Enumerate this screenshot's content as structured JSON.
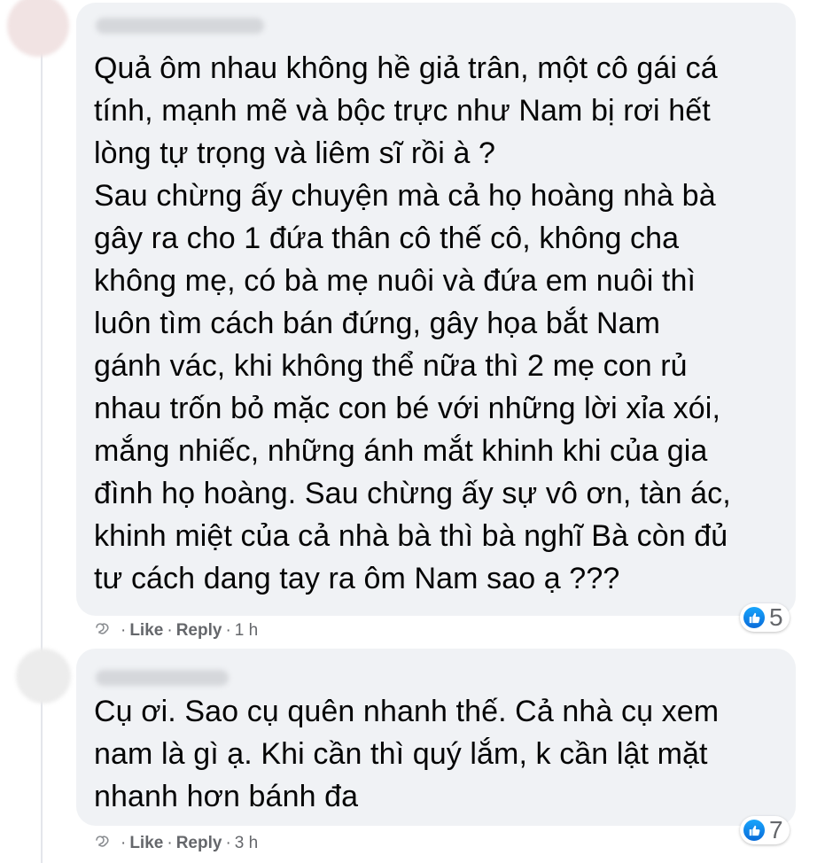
{
  "comments": [
    {
      "text": "Quả ôm nhau không hề giả trân, một cô gái cá\ntính, mạnh mẽ và bộc trực như Nam bị rơi hết\nlòng tự trọng và liêm sĩ rồi à ?\nSau chừng ấy chuyện mà cả họ hoàng nhà bà\ngây ra cho 1 đứa thân cô thế cô, không cha\nkhông mẹ, có bà mẹ nuôi và đứa em nuôi thì\nluôn tìm cách bán đứng, gây họa bắt Nam\ngánh vác, khi không thể nữa thì 2 mẹ con rủ\nnhau trốn bỏ mặc con bé với những lời xỉa xói,\nmắng nhiếc, những ánh mắt khinh khi của gia\nđình họ hoàng. Sau chừng ấy sự vô ơn, tàn ác,\nkhinh miệt của cả nhà bà thì bà nghĩ Bà còn đủ\ntư cách dang tay ra ôm Nam sao ạ ???",
      "reaction_count": "5",
      "like_label": "Like",
      "reply_label": "Reply",
      "separator": "·",
      "time": "1 h"
    },
    {
      "text": "Cụ ơi. Sao cụ quên nhanh thế. Cả nhà cụ xem\nnam là gì ạ. Khi cần thì quý lắm, k cần lật mặt\nnhanh hơn bánh đa",
      "reaction_count": "7",
      "like_label": "Like",
      "reply_label": "Reply",
      "separator": "·",
      "time": "3 h"
    }
  ],
  "colors": {
    "bubble": "#f0f2f5",
    "text": "#050505",
    "meta": "#65676b",
    "like_blue": "#1877f2"
  },
  "icons": [
    "thumbs-up-icon",
    "translate-icon"
  ]
}
